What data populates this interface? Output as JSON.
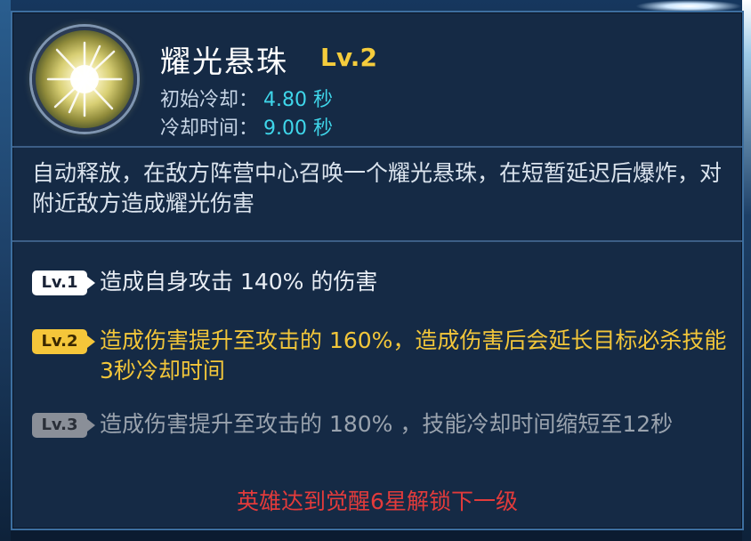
{
  "skill": {
    "name": "耀光悬珠",
    "level": "Lv.2",
    "initial_cooldown_label": "初始冷却：",
    "initial_cooldown_value": "4.80 秒",
    "cooldown_label": "冷却时间：",
    "cooldown_value": "9.00 秒",
    "icon": "radiant-orb-icon"
  },
  "description": "自动释放，在敌方阵营中心召唤一个耀光悬珠，在短暂延迟后爆炸，对附近敌方造成耀光伤害",
  "levels": [
    {
      "badge": "Lv.1",
      "text": "造成自身攻击 140% 的伤害",
      "state": "unlocked"
    },
    {
      "badge": "Lv.2",
      "text": "造成伤害提升至攻击的 160%，造成伤害后会延长目标必杀技能3秒冷却时间",
      "state": "current"
    },
    {
      "badge": "Lv.3",
      "text": "造成伤害提升至攻击的 180% ，技能冷却时间缩短至12秒",
      "state": "locked"
    }
  ],
  "unlock_hint": "英雄达到觉醒6星解锁下一级",
  "colors": {
    "panel_bg": "#152a45",
    "gold": "#f5cc3c",
    "cyan": "#3fd6ea",
    "locked_gray": "#9aa3ae",
    "warning_red": "#e23b3b"
  }
}
